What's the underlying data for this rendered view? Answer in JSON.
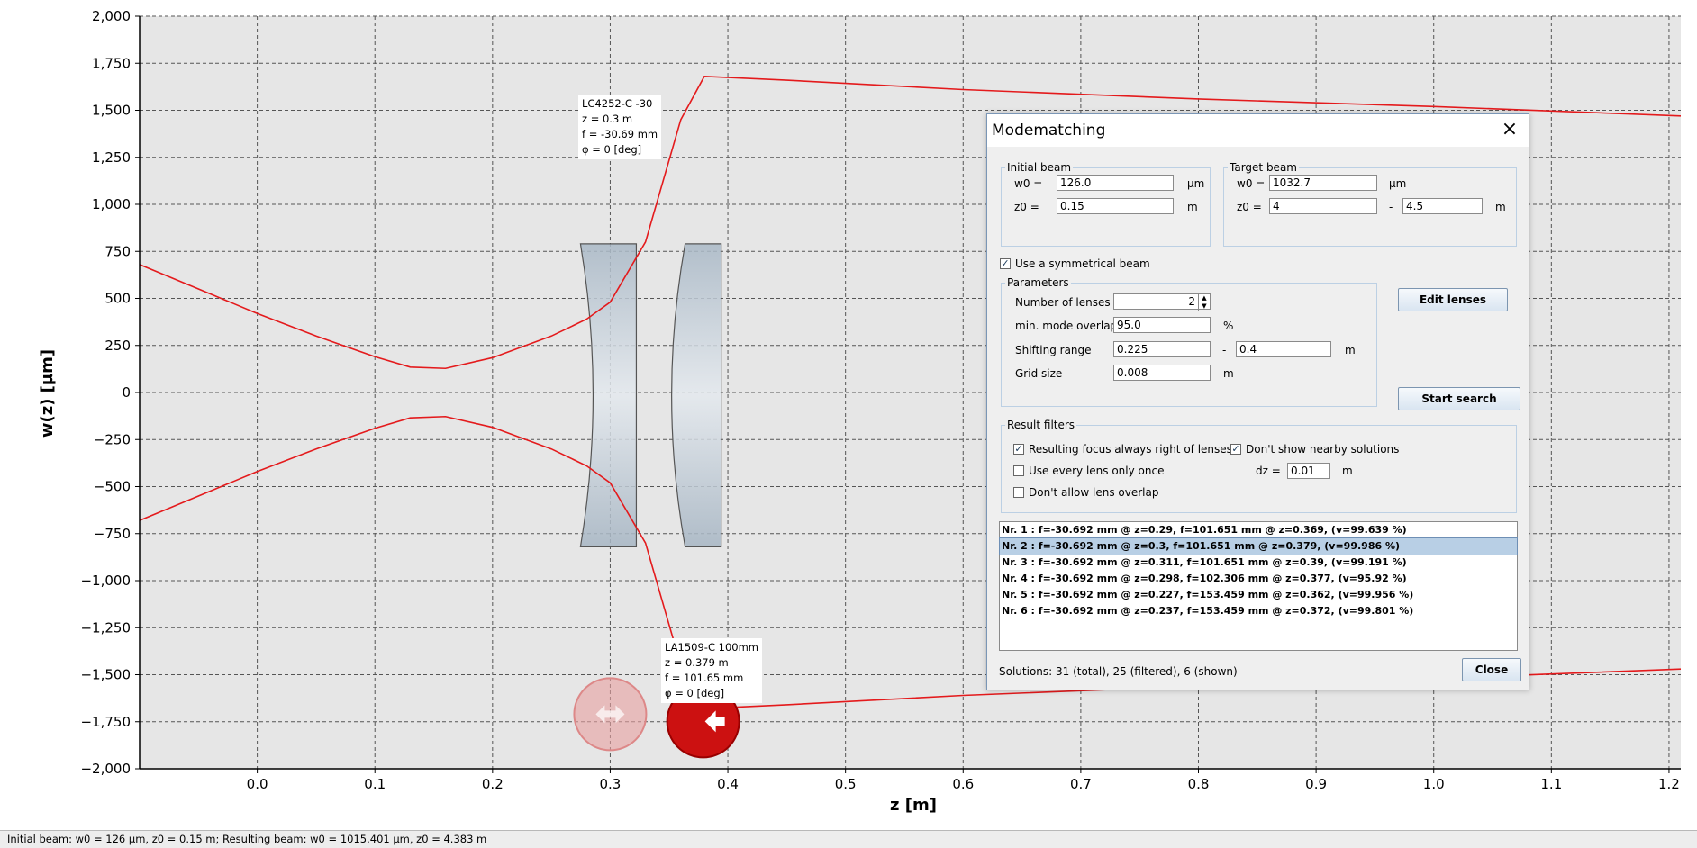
{
  "chart_data": {
    "type": "line",
    "xlabel": "z [m]",
    "ylabel": "w(z) [µm]",
    "xlim": [
      -0.1,
      1.21
    ],
    "ylim": [
      -2000,
      2000
    ],
    "xticks": [
      0.0,
      0.1,
      0.2,
      0.3,
      0.4,
      0.5,
      0.6,
      0.7,
      0.8,
      0.9,
      1.0,
      1.1,
      1.2
    ],
    "xtick_labels": [
      "0.0",
      "0.1",
      "0.2",
      "0.3",
      "0.4",
      "0.5",
      "0.6",
      "0.7",
      "0.8",
      "0.9",
      "1.0",
      "1.1",
      "1.2"
    ],
    "yticks": [
      -2000,
      -1750,
      -1500,
      -1250,
      -1000,
      -750,
      -500,
      -250,
      0,
      250,
      500,
      750,
      1000,
      1250,
      1500,
      1750,
      2000
    ],
    "ytick_labels": [
      "−2,000",
      "−1,750",
      "−1,500",
      "−1,250",
      "−1,000",
      "−750",
      "−500",
      "−250",
      "0",
      "250",
      "500",
      "750",
      "1,000",
      "1,250",
      "1,500",
      "1,750",
      "2,000"
    ],
    "grid": true,
    "series": [
      {
        "color": "#e41a1c",
        "x": [
          -0.1,
          -0.05,
          0.0,
          0.05,
          0.1,
          0.13,
          0.16,
          0.2,
          0.25,
          0.28,
          0.3,
          0.33,
          0.36,
          0.38,
          0.45,
          0.6,
          0.8,
          1.0,
          1.21
        ],
        "y": [
          680,
          550,
          420,
          300,
          190,
          135,
          128,
          185,
          300,
          390,
          480,
          800,
          1450,
          1680,
          1660,
          1610,
          1560,
          1520,
          1470
        ]
      }
    ],
    "mirror_negative": true
  },
  "lenses": [
    {
      "name": "LC4252-C -30",
      "z": "z = 0.3 m",
      "f": "f = -30.69 mm",
      "phi": "φ = 0 [deg]",
      "z_pos": 0.3,
      "type": "concave"
    },
    {
      "name": "LA1509-C 100mm",
      "z": "z = 0.379 m",
      "f": "f = 101.65 mm",
      "phi": "φ = 0 [deg]",
      "z_pos": 0.379,
      "type": "convex"
    }
  ],
  "status": "Initial beam: w0 = 126 µm, z0 = 0.15 m; Resulting beam: w0 = 1015.401 µm, z0 = 4.383 m",
  "dialog": {
    "title": "Modematching",
    "close_icon": "×",
    "initial_beam": {
      "legend": "Initial beam",
      "w0_label": "w0 =",
      "w0": "126.0",
      "w0_unit": "µm",
      "z0_label": "z0 =",
      "z0": "0.15",
      "z0_unit": "m"
    },
    "target_beam": {
      "legend": "Target beam",
      "w0_label": "w0 =",
      "w0": "1032.7",
      "w0_unit": "µm",
      "z0_label": "z0 =",
      "z0_from": "4",
      "dash": "-",
      "z0_to": "4.5",
      "z0_unit": "m"
    },
    "symmetric": {
      "label": "Use a symmetrical beam",
      "checked": true
    },
    "parameters": {
      "legend": "Parameters",
      "num_lenses_label": "Number of lenses",
      "num_lenses": "2",
      "overlap_label": "min. mode overlap",
      "overlap": "95.0",
      "overlap_unit": "%",
      "shift_label": "Shifting range",
      "shift_from": "0.225",
      "dash": "-",
      "shift_to": "0.4",
      "shift_unit": "m",
      "grid_label": "Grid size",
      "grid": "0.008",
      "grid_unit": "m"
    },
    "edit_lenses": "Edit lenses",
    "start_search": "Start search",
    "filters": {
      "legend": "Result filters",
      "focus_right": {
        "label": "Resulting focus always right of lenses",
        "checked": true
      },
      "no_nearby": {
        "label": "Don't show nearby solutions",
        "checked": true
      },
      "every_once": {
        "label": "Use every lens only once",
        "checked": false
      },
      "no_overlap": {
        "label": "Don't allow lens overlap",
        "checked": false
      },
      "dz_label": "dz =",
      "dz": "0.01",
      "dz_unit": "m"
    },
    "results": [
      "Nr. 1 : f=-30.692 mm @ z=0.29, f=101.651 mm @ z=0.369,  (v=99.639 %)",
      "Nr. 2 : f=-30.692 mm @ z=0.3, f=101.651 mm @ z=0.379,  (v=99.986 %)",
      "Nr. 3 : f=-30.692 mm @ z=0.311, f=101.651 mm @ z=0.39,  (v=99.191 %)",
      "Nr. 4 : f=-30.692 mm @ z=0.298, f=102.306 mm @ z=0.377,  (v=95.92 %)",
      "Nr. 5 : f=-30.692 mm @ z=0.227, f=153.459 mm @ z=0.362,  (v=99.956 %)",
      "Nr. 6 : f=-30.692 mm @ z=0.237, f=153.459 mm @ z=0.372,  (v=99.801 %)"
    ],
    "selected_result": 1,
    "solutions": "Solutions: 31 (total), 25 (filtered), 6 (shown)",
    "close_button": "Close"
  }
}
